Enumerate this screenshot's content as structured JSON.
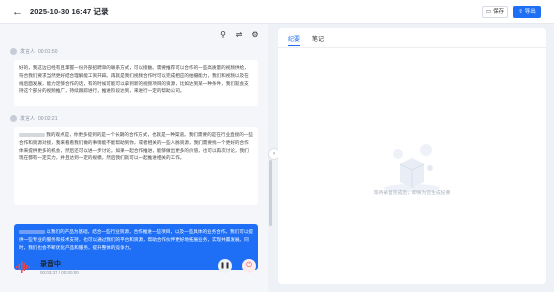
{
  "header": {
    "back_icon": "arrow-left-icon",
    "title": "2025-10-30 16:47 记录",
    "save_label": "保存",
    "export_label": "导出"
  },
  "toolbar": {
    "icons": [
      "search-icon",
      "translate-icon",
      "settings-icon"
    ]
  },
  "transcript": [
    {
      "speaker": "发言人",
      "time": "00:01:50",
      "text": "好的，我这边已经有且掌握一份外部招聘单的联系方式，可以接触。需要推荐可以合作的一些高质量的视频供给，符合我们要求当然更好结合理解能工资开辟。再就是我们视频合作时可以完成相应的拍摄能力，我们和视频以及在线后面发展，能力足够合作的话，有的时候可能可以拿到新的视频项目的资源，比如达到某一种条件，我们就会支持这个部分的视频推广，持续跟踪进行，推进阶段达到，来进行一定的帮助公司。",
      "active": false
    },
    {
      "speaker": "发言人",
      "time": "00:02:21",
      "text": "我的观点是，你更多提到的是一个长期的合作方式，也就是一种渠道。我们需要的是在行业直接的一些合作和资源对接，我来看看我们做的事情能不能帮助到你，或者相关的一些人脉资源，我们需要找一个更好的合作体来提供更多的机会，然后还可以进一步讨论。如果一起合作推进，能够做出更多的价值，也可以再次讨论，我们现在都有一定实力，并且达到一定的规模，然后我们就可以一起推进相关的工作。",
      "active": false
    },
    {
      "speaker": "",
      "time": "",
      "text": "以我们的产品为基础，结合一些行业资源，合作推进一些项目，以及一些具体的业务合作。我们可以提供一些专业的服务和技术支持，也可以通过我们的平台和资源，帮助合作伙伴更好地拓展业务，实现共赢发展。同时，我们也会不断优化产品和服务，提升整体的竞争力。",
      "active": true
    }
  ],
  "recorder": {
    "icon": "waveform-icon",
    "label": "录音中",
    "time": "00:03:37 / 00:00:00",
    "pause_icon": "pause-icon",
    "stop_icon": "power-icon"
  },
  "panel": {
    "tabs": [
      "纪要",
      "笔记"
    ],
    "active_tab": "纪要",
    "empty_text": "等待录音完成后，即将为您生成纪要"
  },
  "colors": {
    "accent": "#1e6ff5",
    "danger": "#e5484d"
  }
}
